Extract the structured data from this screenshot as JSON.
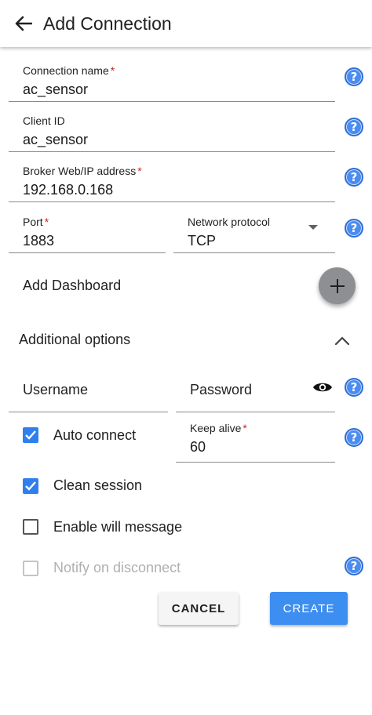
{
  "header": {
    "title": "Add Connection"
  },
  "fields": {
    "connection_name": {
      "label": "Connection name",
      "required": "*",
      "value": "ac_sensor"
    },
    "client_id": {
      "label": "Client ID",
      "value": "ac_sensor"
    },
    "broker": {
      "label": "Broker Web/IP address",
      "required": "*",
      "value": "192.168.0.168"
    },
    "port": {
      "label": "Port",
      "required": "*",
      "value": "1883"
    },
    "protocol": {
      "label": "Network protocol",
      "value": "TCP"
    },
    "username": {
      "placeholder": "Username"
    },
    "password": {
      "placeholder": "Password"
    },
    "keep_alive": {
      "label": "Keep alive",
      "required": "*",
      "value": "60"
    }
  },
  "add_dashboard": {
    "label": "Add Dashboard"
  },
  "additional_options": {
    "label": "Additional options"
  },
  "checkboxes": {
    "auto_connect": {
      "label": "Auto connect",
      "checked": true
    },
    "clean_session": {
      "label": "Clean session",
      "checked": true
    },
    "will_message": {
      "label": "Enable will message",
      "checked": false
    },
    "notify_disconnect": {
      "label": "Notify on disconnect",
      "checked": false
    }
  },
  "buttons": {
    "cancel": "CANCEL",
    "create": "CREATE"
  },
  "icons": {
    "help": "?"
  },
  "colors": {
    "accent": "#3d8ef1",
    "help": "#4a8cf0",
    "fab": "#8d8f93",
    "required": "#c62828"
  }
}
